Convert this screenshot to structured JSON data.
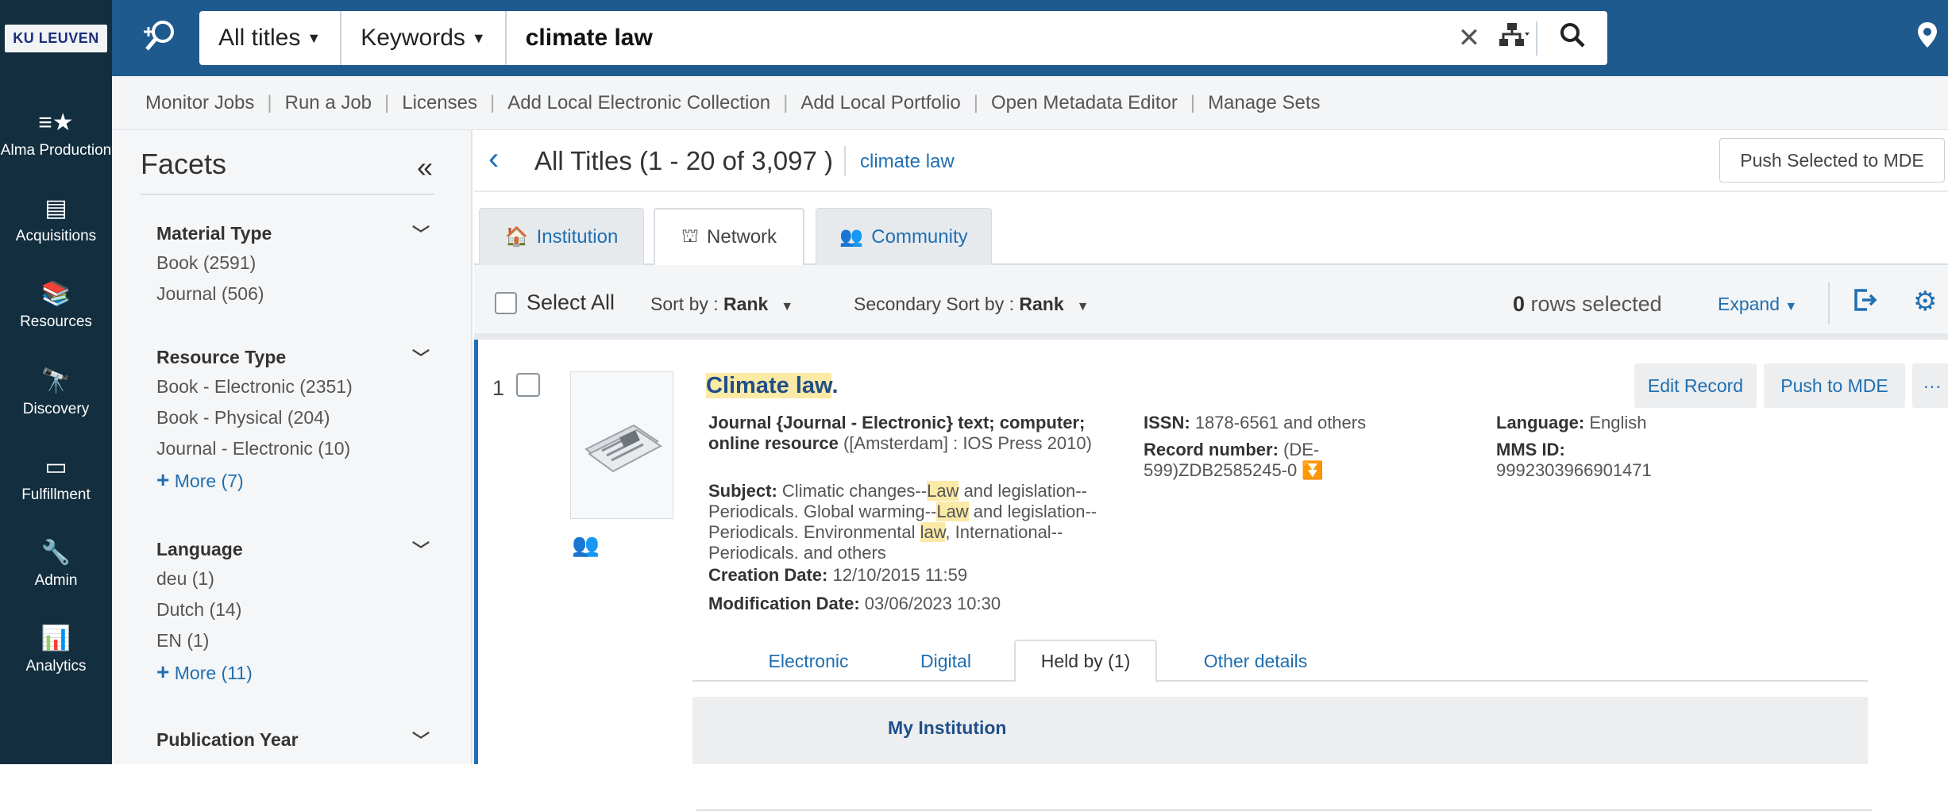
{
  "logo": "KU LEUVEN",
  "nav": [
    {
      "icon": "≡★",
      "label": "Alma Production"
    },
    {
      "icon": "▤",
      "label": "Acquisitions"
    },
    {
      "icon": "📚",
      "label": "Resources"
    },
    {
      "icon": "🔭",
      "label": "Discovery"
    },
    {
      "icon": "▭",
      "label": "Fulfillment"
    },
    {
      "icon": "🔧",
      "label": "Admin"
    },
    {
      "icon": "📊",
      "label": "Analytics"
    }
  ],
  "search": {
    "scope": "All titles",
    "field": "Keywords",
    "term": "climate law"
  },
  "menu": [
    "Monitor Jobs",
    "Run a Job",
    "Licenses",
    "Add Local Electronic Collection",
    "Add Local Portfolio",
    "Open Metadata Editor",
    "Manage Sets"
  ],
  "facets": {
    "title": "Facets",
    "groups": [
      {
        "name": "Material Type",
        "options": [
          "Book (2591)",
          "Journal (506)"
        ],
        "more": ""
      },
      {
        "name": "Resource Type",
        "options": [
          "Book - Electronic (2351)",
          "Book - Physical (204)",
          "Journal - Electronic (10)"
        ],
        "more": "More (7)"
      },
      {
        "name": "Language",
        "options": [
          "deu (1)",
          "Dutch (14)",
          "EN (1)"
        ],
        "more": "More (11)"
      },
      {
        "name": "Publication Year",
        "options": [],
        "more": ""
      }
    ]
  },
  "results": {
    "title": "All Titles (1 - 20 of 3,097 )",
    "crumb": "climate law",
    "push_selected": "Push Selected to MDE",
    "tabs": [
      "Institution",
      "Network",
      "Community"
    ],
    "select_all": "Select All",
    "sort_label": "Sort by :",
    "sort_value": "Rank",
    "secondary_sort_label": "Secondary Sort by :",
    "secondary_sort_value": "Rank",
    "rows_selected_count": "0",
    "rows_selected_text": "rows selected",
    "expand": "Expand"
  },
  "record": {
    "number": "1",
    "title_hl": "Climate law",
    "title_tail": ".",
    "type_bold": "Journal {Journal - Electronic} text; computer; online resource",
    "type_tail": " ([Amsterdam] : IOS Press 2010)",
    "subject_label": "Subject:",
    "subject_parts": [
      "Climatic changes--",
      "Law",
      " and legislation--Periodicals. Global warming--",
      "Law",
      " and legislation--Periodicals. Environmental ",
      "law",
      ", International--Periodicals. and others"
    ],
    "creation_label": "Creation Date:",
    "creation_value": "12/10/2015 11:59",
    "modification_label": "Modification Date:",
    "modification_value": "03/06/2023 10:30",
    "issn_label": "ISSN:",
    "issn_value": "1878-6561 and others",
    "recnum_label": "Record number:",
    "recnum_value": "(DE-599)ZDB2585245-0",
    "language_label": "Language:",
    "language_value": "English",
    "mms_label": "MMS ID:",
    "mms_value": "9992303966901471",
    "edit_record": "Edit Record",
    "push_mde": "Push to MDE",
    "more": "···",
    "tabs": [
      "Electronic",
      "Digital",
      "Held by (1)",
      "Other details"
    ],
    "institution": "My Institution"
  }
}
